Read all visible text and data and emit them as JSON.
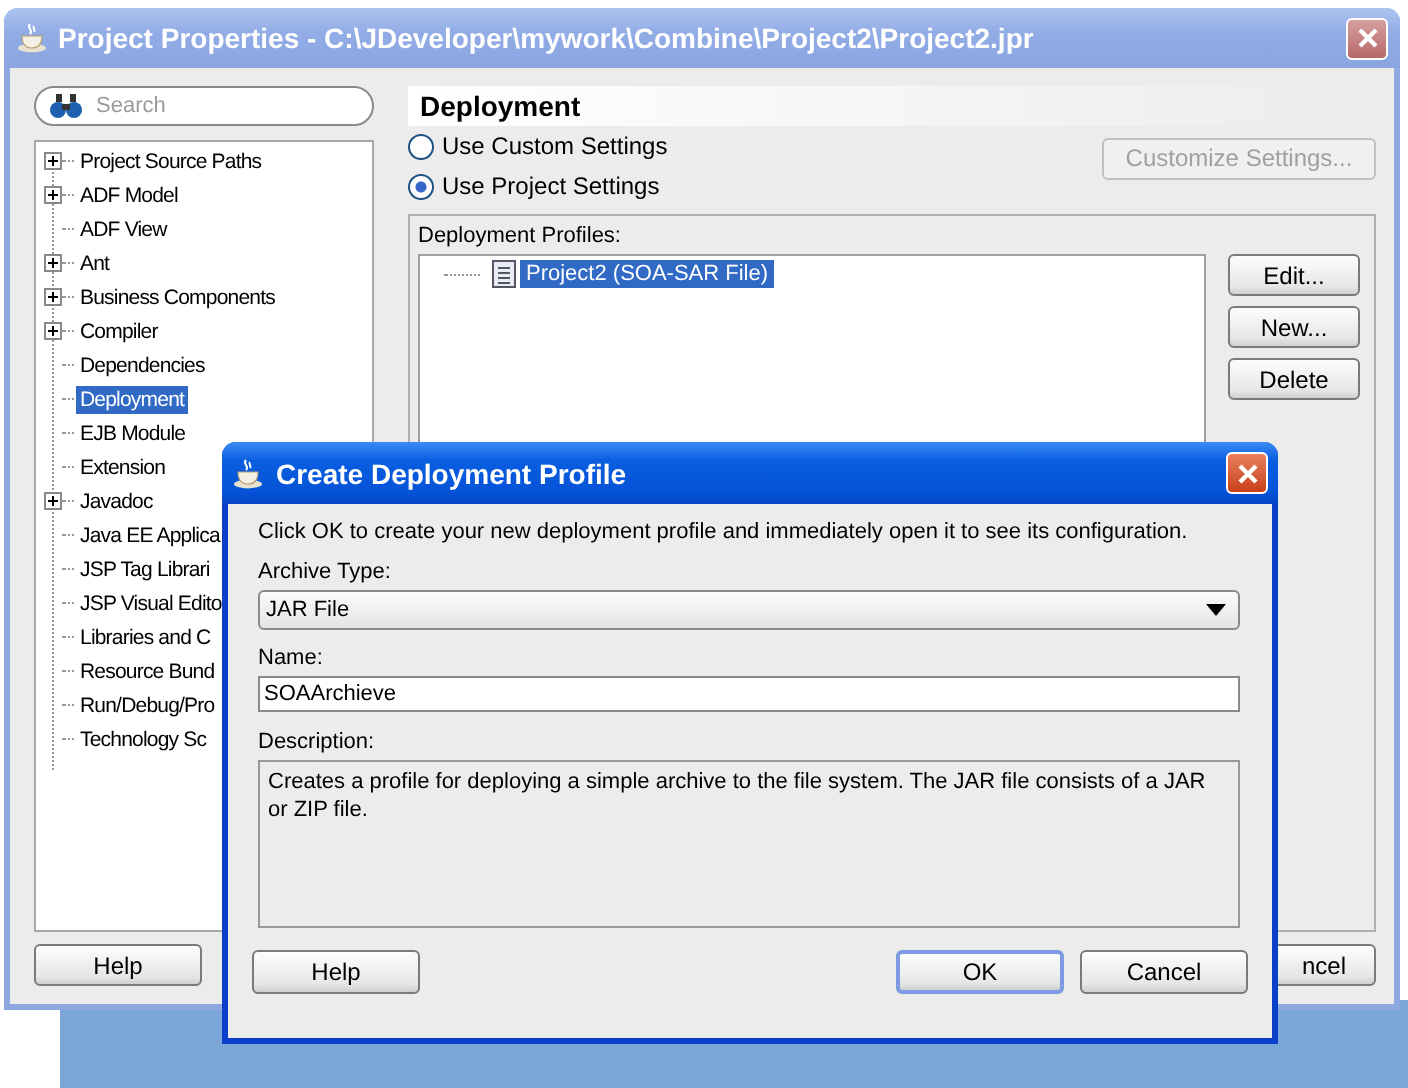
{
  "window": {
    "title": "Project Properties - C:\\JDeveloper\\mywork\\Combine\\Project2\\Project2.jpr"
  },
  "search": {
    "placeholder": "Search"
  },
  "tree": [
    {
      "label": "Project Source Paths",
      "expandable": true,
      "selected": false
    },
    {
      "label": "ADF Model",
      "expandable": true,
      "selected": false
    },
    {
      "label": "ADF View",
      "expandable": false,
      "selected": false
    },
    {
      "label": "Ant",
      "expandable": true,
      "selected": false
    },
    {
      "label": "Business Components",
      "expandable": true,
      "selected": false
    },
    {
      "label": "Compiler",
      "expandable": true,
      "selected": false
    },
    {
      "label": "Dependencies",
      "expandable": false,
      "selected": false
    },
    {
      "label": "Deployment",
      "expandable": false,
      "selected": true
    },
    {
      "label": "EJB Module",
      "expandable": false,
      "selected": false
    },
    {
      "label": "Extension",
      "expandable": false,
      "selected": false
    },
    {
      "label": "Javadoc",
      "expandable": true,
      "selected": false
    },
    {
      "label": "Java EE Applica",
      "expandable": false,
      "selected": false
    },
    {
      "label": "JSP Tag Librari",
      "expandable": false,
      "selected": false
    },
    {
      "label": "JSP Visual Edito",
      "expandable": false,
      "selected": false
    },
    {
      "label": "Libraries and C",
      "expandable": false,
      "selected": false
    },
    {
      "label": "Resource Bund",
      "expandable": false,
      "selected": false
    },
    {
      "label": "Run/Debug/Pro",
      "expandable": false,
      "selected": false
    },
    {
      "label": "Technology Sc",
      "expandable": false,
      "selected": false
    }
  ],
  "panel": {
    "title": "Deployment",
    "radios": [
      {
        "label": "Use Custom Settings",
        "selected": false
      },
      {
        "label": "Use Project Settings",
        "selected": true
      }
    ],
    "customize_button": {
      "label": "Customize Settings...",
      "disabled": true
    },
    "profiles": {
      "label": "Deployment Profiles:",
      "items": [
        {
          "label": "Project2 (SOA-SAR File)",
          "selected": true
        }
      ]
    },
    "buttons": [
      {
        "label": "Edit..."
      },
      {
        "label": "New..."
      },
      {
        "label": "Delete"
      }
    ]
  },
  "footer": {
    "help": {
      "label": "Help"
    },
    "cancel": {
      "label": "ncel"
    }
  },
  "dialog": {
    "title": "Create Deployment Profile",
    "intro": "Click OK to create your new deployment profile and immediately open it to see its configuration.",
    "archive_type": {
      "label": "Archive Type:",
      "value": "JAR File"
    },
    "name": {
      "label": "Name:",
      "value": "SOAArchieve"
    },
    "description": {
      "label": "Description:",
      "text": "Creates a profile for deploying a simple archive to the file system. The JAR file consists of a JAR or ZIP file."
    },
    "help": {
      "label": "Help"
    },
    "buttons": [
      {
        "label": "OK",
        "default": true
      },
      {
        "label": "Cancel",
        "default": false
      }
    ]
  }
}
